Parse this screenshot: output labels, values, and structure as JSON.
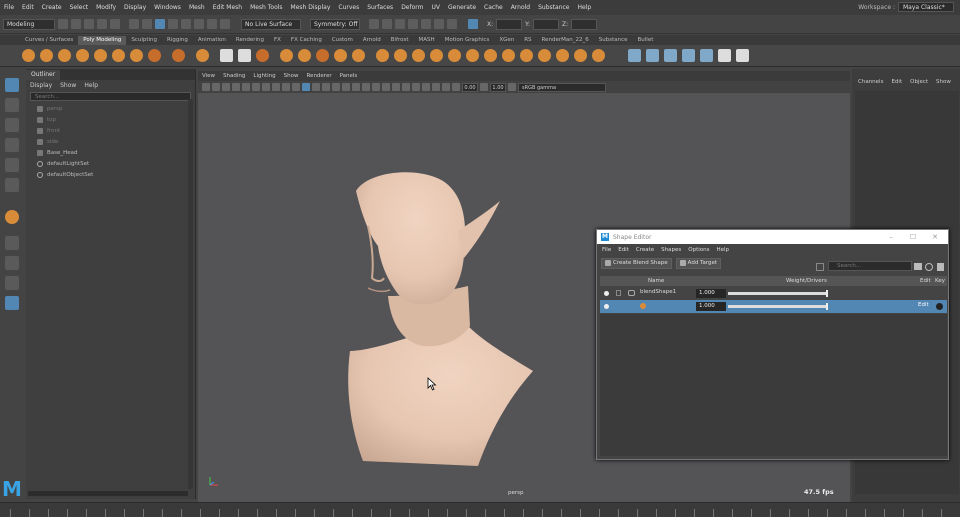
{
  "menubar": {
    "items": [
      "File",
      "Edit",
      "Create",
      "Select",
      "Modify",
      "Display",
      "Windows",
      "Mesh",
      "Edit Mesh",
      "Mesh Tools",
      "Mesh Display",
      "Curves",
      "Surfaces",
      "Deform",
      "UV",
      "Generate",
      "Cache",
      "Arnold",
      "Substance",
      "Help"
    ],
    "workspace_label": "Workspace :",
    "workspace_value": "Maya Classic*"
  },
  "statusline": {
    "mode_menu": "Modeling",
    "live_surface": "No Live Surface",
    "symmetry": "Symmetry: Off",
    "x_label": "X:",
    "y_label": "Y:",
    "z_label": "Z:"
  },
  "shelf": {
    "tabs": [
      "Curves / Surfaces",
      "Poly Modeling",
      "Sculpting",
      "Rigging",
      "Animation",
      "Rendering",
      "FX",
      "FX Caching",
      "Custom",
      "Arnold",
      "Bifrost",
      "MASH",
      "Motion Graphics",
      "XGen",
      "RS",
      "RenderMan_22_6",
      "Substance",
      "Bullet"
    ],
    "active_tab_index": 1
  },
  "outliner": {
    "tab": "Outliner",
    "menu": [
      "Display",
      "Show",
      "Help"
    ],
    "search_placeholder": "Search...",
    "items": [
      {
        "label": "persp",
        "dim": true,
        "icon": "camera-icon"
      },
      {
        "label": "top",
        "dim": true,
        "icon": "camera-icon"
      },
      {
        "label": "front",
        "dim": true,
        "icon": "camera-icon"
      },
      {
        "label": "side",
        "dim": true,
        "icon": "camera-icon"
      },
      {
        "label": "Base_Head",
        "dim": false,
        "icon": "mesh-icon"
      },
      {
        "label": "defaultLightSet",
        "dim": false,
        "icon": "set-icon"
      },
      {
        "label": "defaultObjectSet",
        "dim": false,
        "icon": "set-icon"
      }
    ]
  },
  "viewport": {
    "menu": [
      "View",
      "Shading",
      "Lighting",
      "Show",
      "Renderer",
      "Panels"
    ],
    "near_value": "0.00",
    "gamma_value": "1.00",
    "color_space": "sRGB gamma",
    "camera_label": "persp",
    "fps": "47.5 fps",
    "colors": {
      "background": "#545356",
      "skin": "#e6c6b1"
    }
  },
  "channelbox": {
    "menu": [
      "Channels",
      "Edit",
      "Object",
      "Show"
    ]
  },
  "shape_editor": {
    "title": "Shape Editor",
    "menu": [
      "File",
      "Edit",
      "Create",
      "Shapes",
      "Options",
      "Help"
    ],
    "create_blend_shape": "Create Blend Shape",
    "add_target": "Add Target",
    "search_placeholder": "Search...",
    "columns": {
      "name": "Name",
      "weight": "Weight/Drivers",
      "edit": "Edit",
      "key": "Key"
    },
    "rows": [
      {
        "name": "blendShape1",
        "weight": "1.000",
        "weight_fraction": 1.0,
        "selected": false,
        "edit_label": ""
      },
      {
        "name": "",
        "weight": "1.000",
        "weight_fraction": 1.0,
        "selected": true,
        "edit_label": "Edit"
      }
    ]
  },
  "timeline": {
    "tick_count": 50
  }
}
